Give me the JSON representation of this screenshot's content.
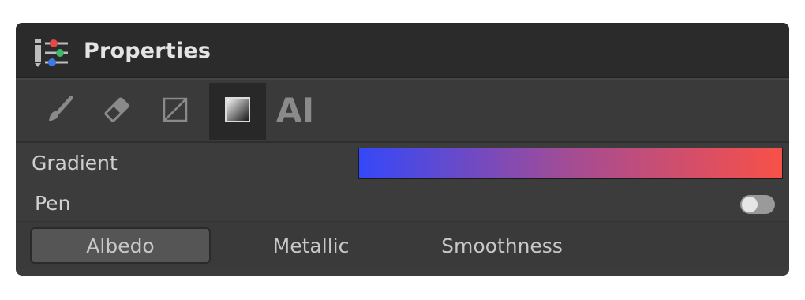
{
  "window": {
    "title": "Properties",
    "icon": "sliders-icon"
  },
  "toolbar": {
    "tools": [
      {
        "name": "brush",
        "icon": "brush-icon"
      },
      {
        "name": "eraser",
        "icon": "eraser-icon"
      },
      {
        "name": "clear",
        "icon": "slash-box-icon"
      },
      {
        "name": "gradient",
        "icon": "gradient-square-icon",
        "active": true
      }
    ],
    "ai_label": "AI"
  },
  "gradient": {
    "label": "Gradient",
    "start_color": "#3448f8",
    "mid_color": "#a44c94",
    "end_color": "#f85048"
  },
  "pen": {
    "label": "Pen",
    "enabled": false
  },
  "tabs": [
    {
      "label": "Albedo",
      "active": true
    },
    {
      "label": "Metallic",
      "active": false
    },
    {
      "label": "Smoothness",
      "active": false
    }
  ],
  "colors": {
    "panel_bg": "#3c3c3c",
    "titlebar_bg": "#2b2b2b",
    "active_tool_bg": "#282828",
    "active_tab_bg": "#555555"
  }
}
